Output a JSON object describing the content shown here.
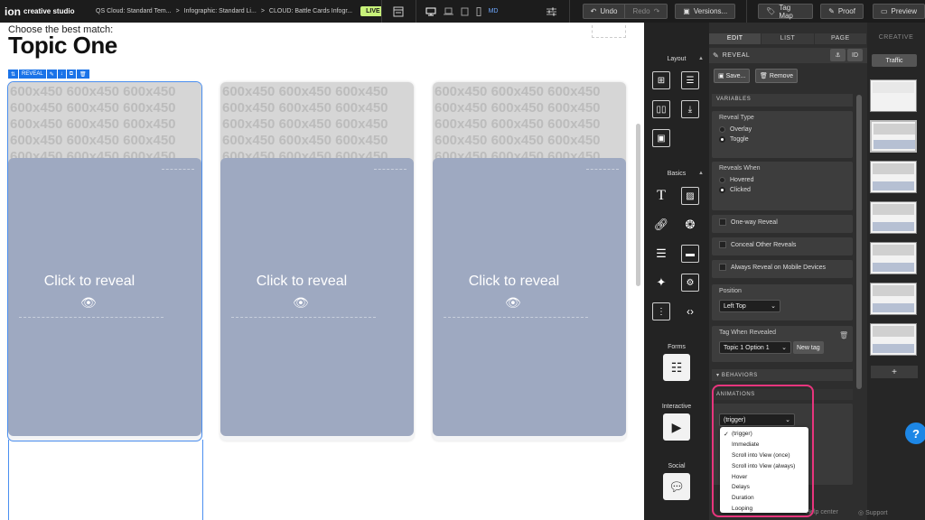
{
  "topbar": {
    "logo_mark": "ion",
    "logo_text": "creative studio",
    "crumbs": [
      "QS Cloud: Standard Tem...",
      "Infographic: Standard Li...",
      "CLOUD: Battle Cards Infogr..."
    ],
    "crumb_sep": ">",
    "live": "LIVE",
    "device_md": "MD",
    "undo": "Undo",
    "redo": "Redo",
    "versions": "Versions...",
    "tag_map": "Tag Map",
    "proof": "Proof",
    "preview": "Preview"
  },
  "canvas": {
    "subtitle": "Choose the best match:",
    "title": "Topic One",
    "reveal_toolbar_label": "REVEAL",
    "placeholder_text": "600x450",
    "cards": [
      {
        "cover_text": "Click to reveal"
      },
      {
        "cover_text": "Click to reveal"
      },
      {
        "cover_text": "Click to reveal"
      }
    ]
  },
  "widgets": {
    "sections": {
      "layout": "Layout",
      "basics": "Basics",
      "forms": "Forms",
      "interactive": "Interactive",
      "social": "Social"
    }
  },
  "props": {
    "tabs": [
      "EDIT",
      "LIST",
      "PAGE"
    ],
    "header_label": "REVEAL",
    "id_label": "ID",
    "save_label": "Save...",
    "remove_label": "Remove",
    "variables_label": "VARIABLES",
    "reveal_type": {
      "title": "Reveal Type",
      "options": [
        "Overlay",
        "Toggle"
      ],
      "selected": "Toggle"
    },
    "reveals_when": {
      "title": "Reveals When",
      "options": [
        "Hovered",
        "Clicked"
      ],
      "selected": "Clicked"
    },
    "checkboxes": [
      "One-way Reveal",
      "Conceal Other Reveals",
      "Always Reveal on Mobile Devices"
    ],
    "position": {
      "title": "Position",
      "value": "Left Top"
    },
    "tag_when_revealed": {
      "title": "Tag When Revealed",
      "value": "Topic 1 Option 1",
      "new_tag": "New tag"
    },
    "behaviors_label": "BEHAVIORS",
    "animations_label": "ANIMATIONS",
    "trigger_select": "(trigger)",
    "dropdown_options": [
      "(trigger)",
      "Immediate",
      "Scroll into View (once)",
      "Scroll into View (always)",
      "Hover",
      "Delays",
      "Duration",
      "Looping"
    ],
    "dropdown_selected": "(trigger)"
  },
  "creative": {
    "tab": "CREATIVE",
    "traffic": "Traffic",
    "add": "+"
  },
  "footer": {
    "help_center": "Help center",
    "support": "Support"
  },
  "help_fab": "?",
  "colors": {
    "accent_blue": "#1a73e8",
    "live_green": "#c8f27a",
    "cover": "#9ea9c1",
    "highlight_pink": "#e8357d"
  }
}
